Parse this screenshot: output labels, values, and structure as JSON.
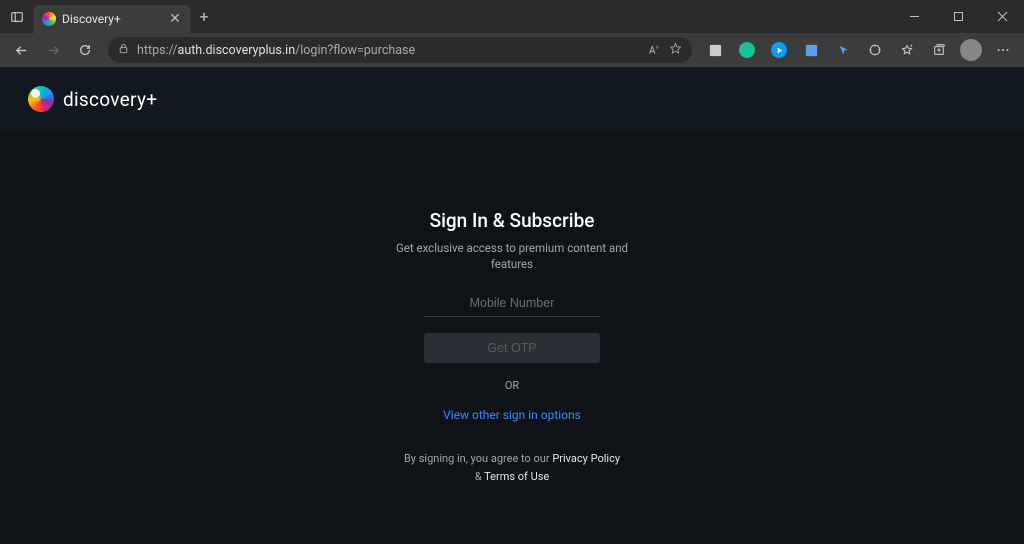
{
  "browser": {
    "tab_title": "Discovery+",
    "url_full": "https://auth.discoveryplus.in/login?flow=purchase",
    "url_scheme": "https://",
    "url_domain": "auth.discoveryplus.in",
    "url_path": "/login?flow=purchase"
  },
  "logo_text": "discovery+",
  "signin": {
    "title": "Sign In & Subscribe",
    "subtitle": "Get exclusive access to premium content and features",
    "mobile_placeholder": "Mobile Number",
    "mobile_value": "",
    "otp_button": "Get OTP",
    "or": "OR",
    "other_options": "View other sign in options",
    "legal_prefix": "By signing in, you agree to our ",
    "privacy": "Privacy Policy",
    "amp": " & ",
    "terms": "Terms of Use"
  }
}
